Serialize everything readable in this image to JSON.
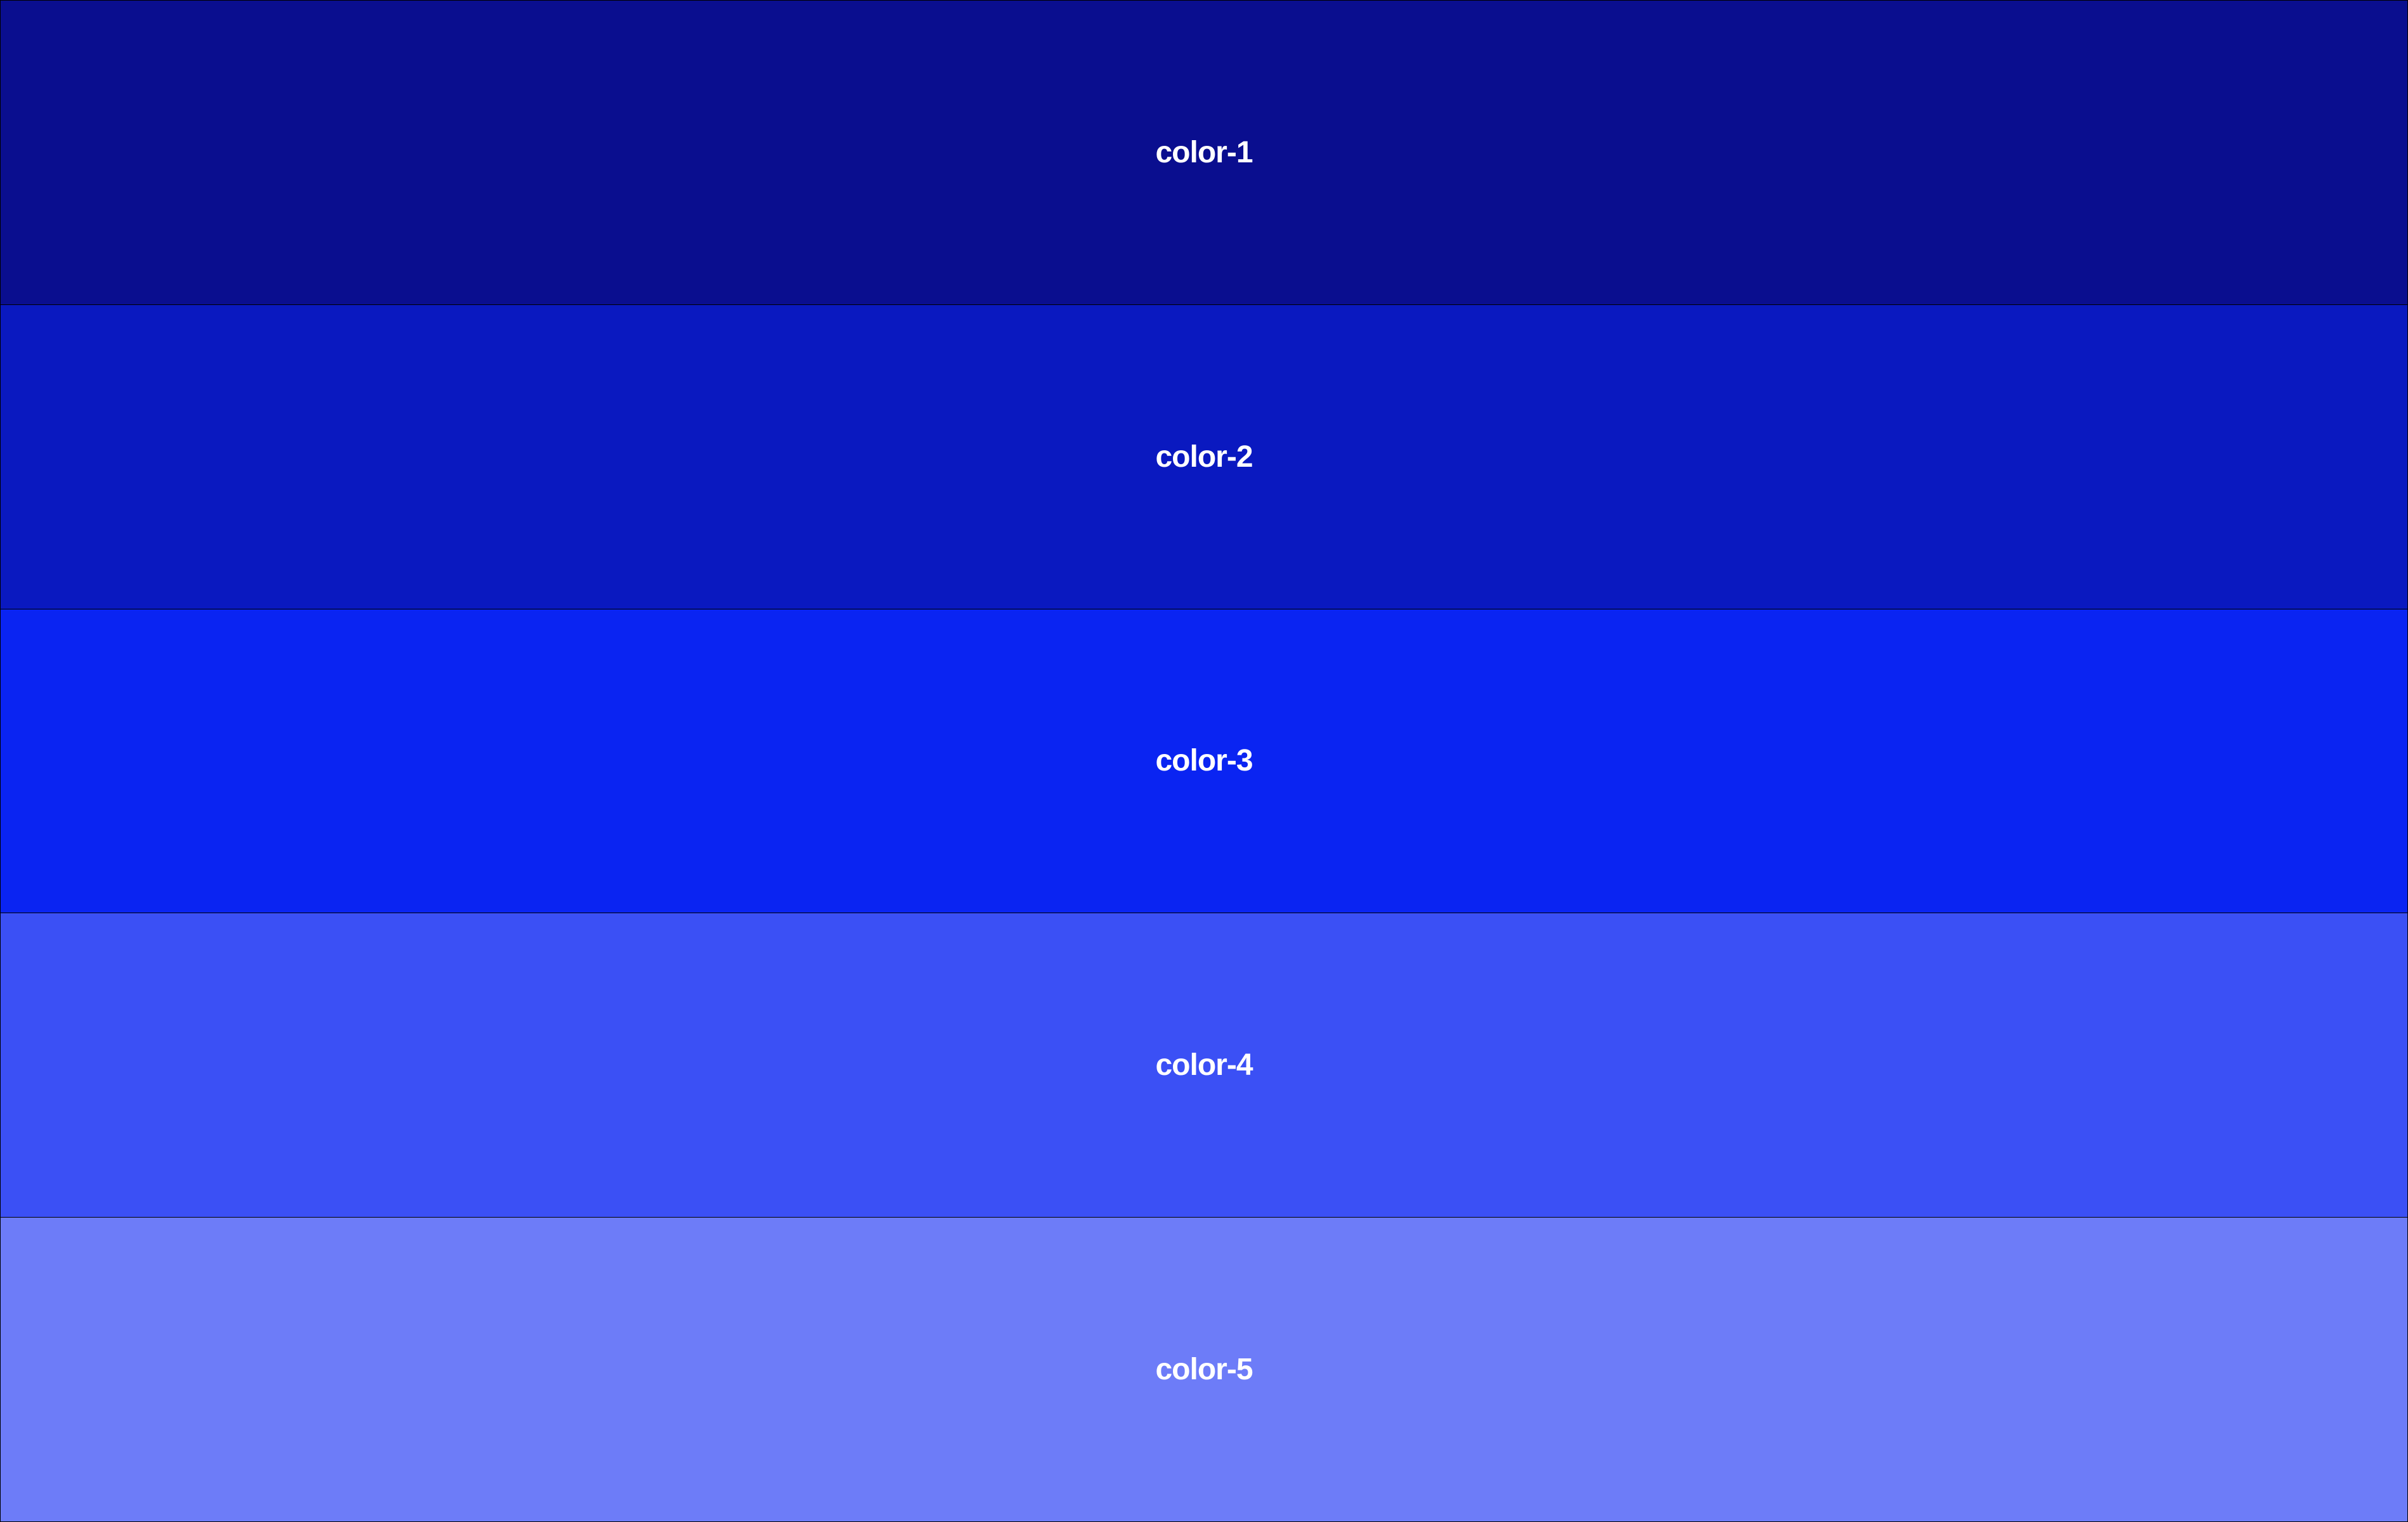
{
  "palette": {
    "swatches": [
      {
        "label": "color-1",
        "hex": "#0A0E8F"
      },
      {
        "label": "color-2",
        "hex": "#0A19C0"
      },
      {
        "label": "color-3",
        "hex": "#0A24F2"
      },
      {
        "label": "color-4",
        "hex": "#3B50F5"
      },
      {
        "label": "color-5",
        "hex": "#6D7CF8"
      }
    ]
  }
}
